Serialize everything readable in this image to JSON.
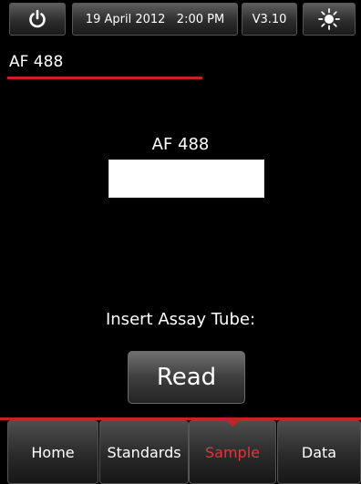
{
  "topbar": {
    "power_icon": "power-icon",
    "datetime": "19 April 2012   2:00 PM",
    "version": "V3.10",
    "brightness_icon": "sun-icon"
  },
  "header": {
    "title": "AF 488"
  },
  "main": {
    "sample_name": "AF 488",
    "value": "",
    "prompt": "Insert Assay Tube:",
    "read_label": "Read"
  },
  "nav": {
    "items": [
      {
        "label": "Home"
      },
      {
        "label": "Standards"
      },
      {
        "label": "Sample"
      },
      {
        "label": "Data"
      }
    ],
    "active": "Sample"
  },
  "colors": {
    "accent": "#c8202a",
    "active_text": "#e0363c",
    "background": "#000000"
  }
}
